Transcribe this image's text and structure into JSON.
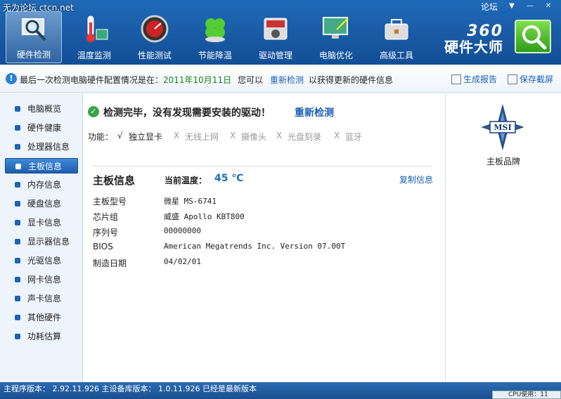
{
  "watermark": "无为论坛 ctcn.net",
  "window_title": "360硬件大师",
  "header": {
    "tabs": [
      {
        "label": "硬件检测",
        "icon": "magnifier-monitor-icon"
      },
      {
        "label": "温度监测",
        "icon": "thermometer-icon"
      },
      {
        "label": "性能测试",
        "icon": "speedometer-icon"
      },
      {
        "label": "节能降温",
        "icon": "clover-icon"
      },
      {
        "label": "驱动管理",
        "icon": "driver-gear-icon"
      },
      {
        "label": "电脑优化",
        "icon": "monitor-wand-icon"
      },
      {
        "label": "高级工具",
        "icon": "toolbox-icon"
      }
    ],
    "active_tab": 0,
    "forum_link": "论坛",
    "brand_number": "360",
    "brand_name": "硬件大师"
  },
  "infobar": {
    "text_prefix": "最后一次检测电脑硬件配置情况是在：",
    "date": "2011年10月11日",
    "text_mid": "您可以",
    "redetect_link": "重新检测",
    "text_suffix": "以获得更新的硬件信息",
    "generate_report": "生成报告",
    "save_screenshot": "保存截屏"
  },
  "sidebar": {
    "items": [
      {
        "label": "电脑概览"
      },
      {
        "label": "硬件健康"
      },
      {
        "label": "处理器信息"
      },
      {
        "label": "主板信息"
      },
      {
        "label": "内存信息"
      },
      {
        "label": "硬盘信息"
      },
      {
        "label": "显卡信息"
      },
      {
        "label": "显示器信息"
      },
      {
        "label": "光驱信息"
      },
      {
        "label": "网卡信息"
      },
      {
        "label": "声卡信息"
      },
      {
        "label": "其他硬件"
      },
      {
        "label": "功耗估算"
      }
    ],
    "active_index": 3
  },
  "main": {
    "status_message": "检测完毕，没有发现需要安装的驱动！",
    "status_link": "重新检测",
    "features_label": "功能：",
    "features": [
      {
        "mark": "√",
        "label": "独立显卡",
        "available": true
      },
      {
        "mark": "X",
        "label": "无线上网",
        "available": false
      },
      {
        "mark": "X",
        "label": "摄像头",
        "available": false
      },
      {
        "mark": "X",
        "label": "光盘刻录",
        "available": false
      },
      {
        "mark": "X",
        "label": "蓝牙",
        "available": false
      }
    ],
    "section_title": "主板信息",
    "temp_label": "当前温度：",
    "temp_value": "45 ℃",
    "copy_link": "复制信息",
    "rows": [
      {
        "key": "主板型号",
        "value": "微星 MS-6741"
      },
      {
        "key": "芯片组",
        "value": "威盛 Apollo KBT800"
      },
      {
        "key": "序列号",
        "value": "00000000"
      },
      {
        "key": "BIOS",
        "value": "American Megatrends Inc. Version 07.00T"
      },
      {
        "key": "制造日期",
        "value": "04/02/01"
      }
    ]
  },
  "right_panel": {
    "logo_text": "MSI",
    "label": "主板品牌"
  },
  "statusbar": {
    "text": "主程序版本： 2.92.11.926   主设备库版本： 1.0.11.926  已经是最新版本",
    "cpu_text": "CPU使用：11"
  },
  "colors": {
    "header_blue": "#1a5da8",
    "link_blue": "#1a5fb4",
    "date_green": "#1e7e1e",
    "temp_blue": "#1a6fc0",
    "check_green": "#3aa34a"
  }
}
